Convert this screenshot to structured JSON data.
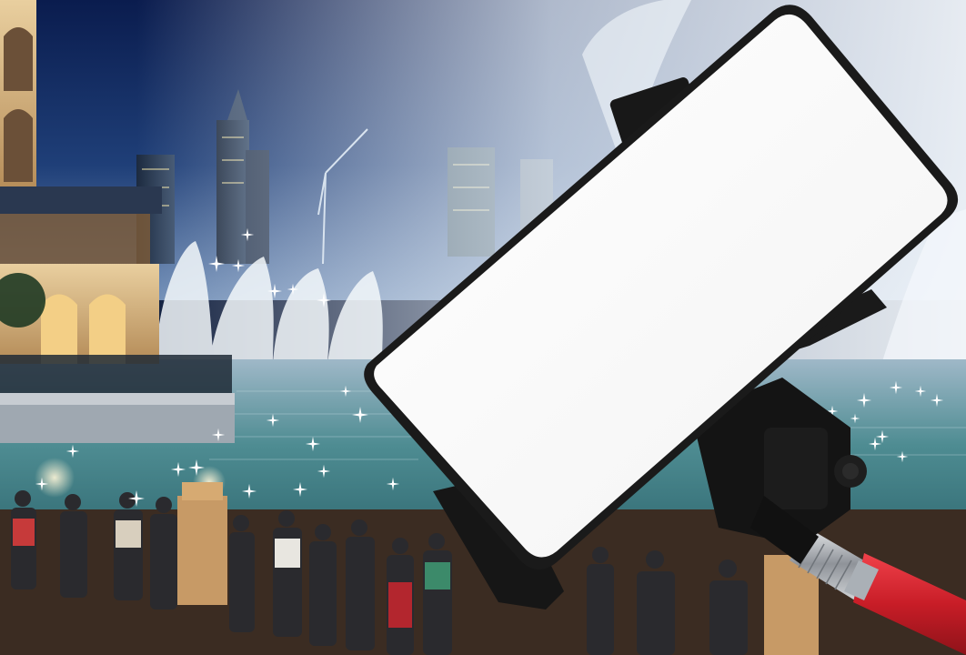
{
  "scene": {
    "colors": {
      "sky_top": "#0c1f55",
      "sky_mid": "#2a4a7a",
      "sky_haze": "#8fa8c8",
      "water": "#3f7f86",
      "water_dark": "#1d4a55",
      "fountain": "#e8eef4",
      "building_stone": "#d9b98a",
      "building_warm": "#f0c77a",
      "phone_screen": "#ffffff",
      "holder_black": "#141414",
      "pole_red": "#d8262f",
      "pole_metal": "#b8bcc0"
    },
    "icons": [
      "sparkle-icon"
    ]
  }
}
